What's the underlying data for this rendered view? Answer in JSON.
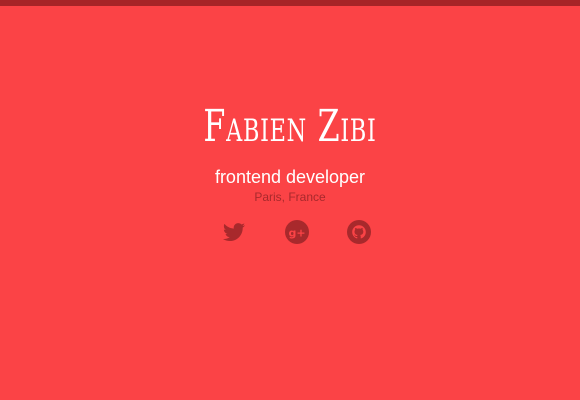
{
  "header": {
    "name": "Fabien Zibi",
    "title": "frontend developer",
    "location": "Paris, France"
  },
  "social_links": [
    {
      "icon": "twitter-icon"
    },
    {
      "icon": "google-plus-icon",
      "glyph": "g+"
    },
    {
      "icon": "github-icon"
    }
  ],
  "colors": {
    "background": "#fb4346",
    "top_bar": "#a62427",
    "icon": "#a8292c",
    "text": "#ffffff"
  }
}
